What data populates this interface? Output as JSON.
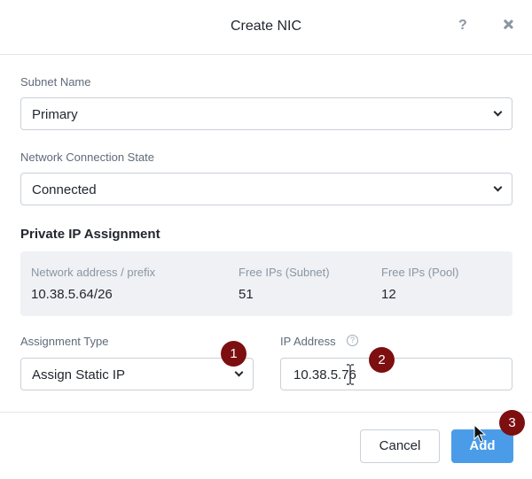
{
  "dialog": {
    "title": "Create NIC",
    "help_label": "?"
  },
  "fields": {
    "subnet_name": {
      "label": "Subnet Name",
      "value": "Primary"
    },
    "connection_state": {
      "label": "Network Connection State",
      "value": "Connected"
    },
    "assignment_type": {
      "label": "Assignment Type",
      "value": "Assign Static IP"
    },
    "ip_address": {
      "label": "IP Address",
      "value": "10.38.5.76",
      "info_glyph": "?"
    }
  },
  "private_ip": {
    "title": "Private IP Assignment",
    "columns": [
      {
        "header": "Network address / prefix",
        "value": "10.38.5.64/26"
      },
      {
        "header": "Free IPs (Subnet)",
        "value": "51"
      },
      {
        "header": "Free IPs (Pool)",
        "value": "12"
      }
    ]
  },
  "footer": {
    "cancel_label": "Cancel",
    "add_label": "Add"
  },
  "annotations": {
    "badges": [
      "1",
      "2",
      "3"
    ],
    "badge_color": "#7d0f10"
  },
  "colors": {
    "primary_button": "#4b9ce8",
    "info_box_bg": "#eff1f4",
    "border": "#c9d0d7"
  },
  "icons": {
    "help": "question-mark-icon",
    "close": "close-icon",
    "dropdown": "chevron-down-icon",
    "info": "info-circle-icon"
  }
}
